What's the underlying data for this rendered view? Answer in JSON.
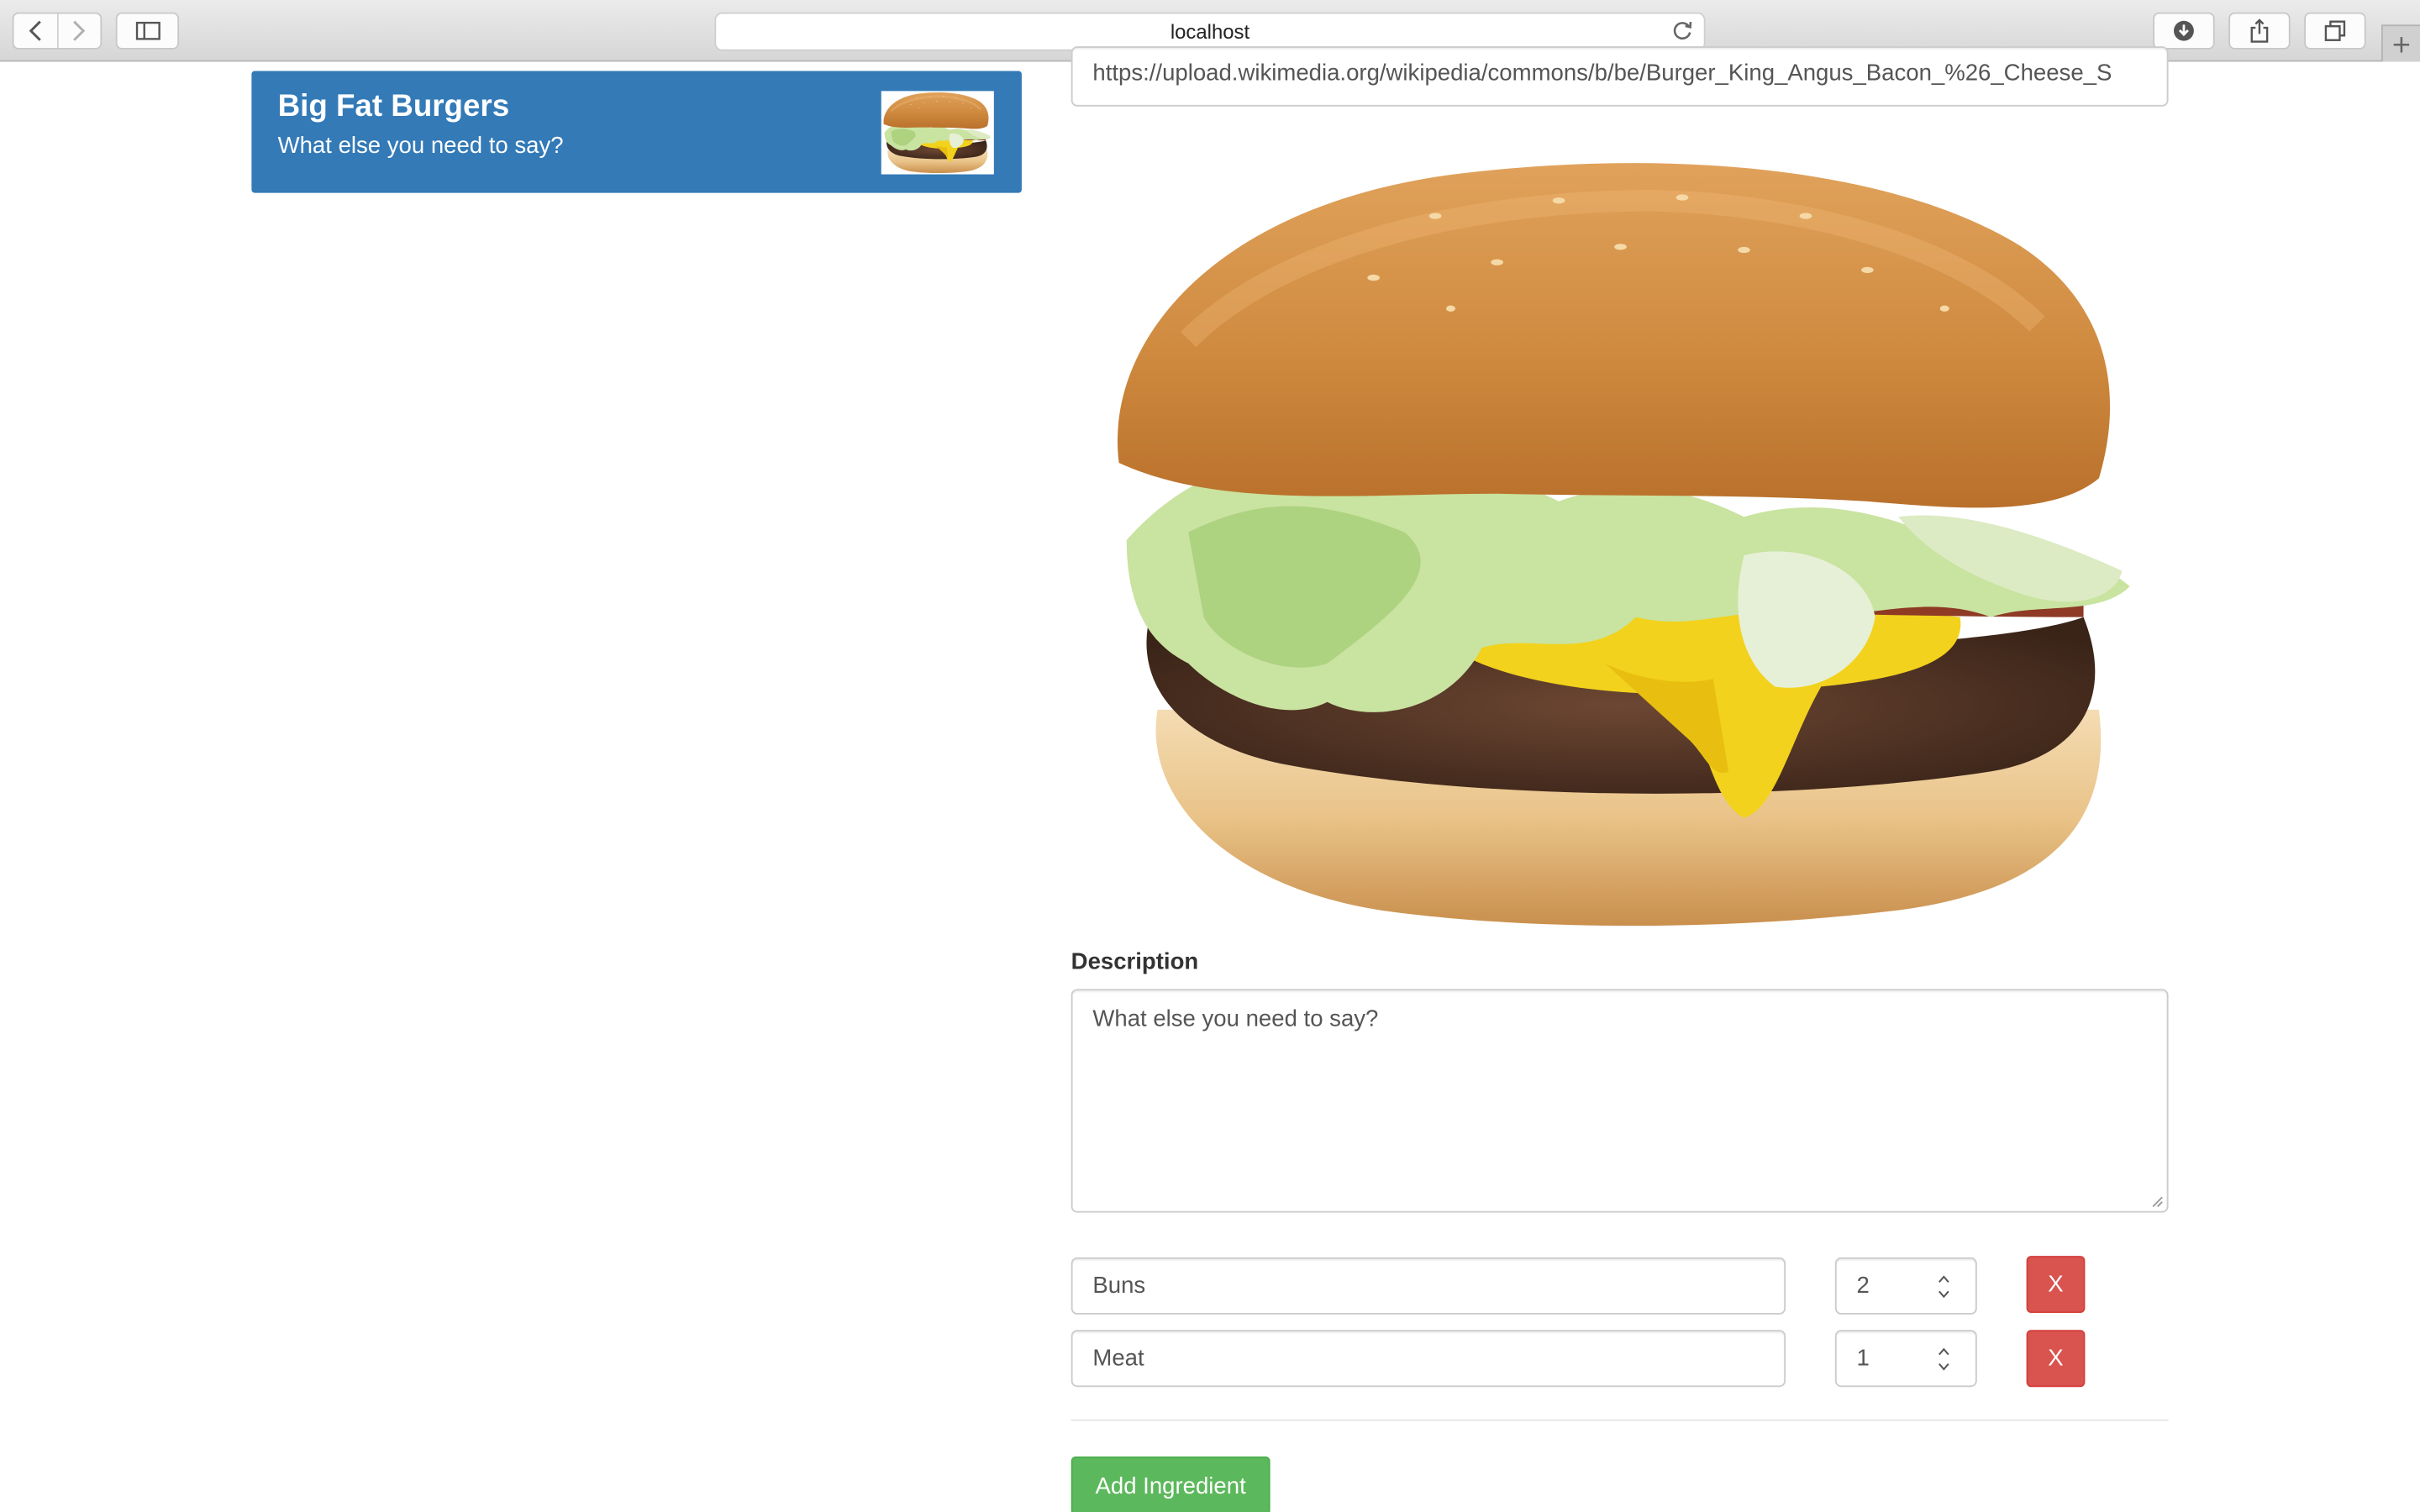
{
  "browser": {
    "url": "localhost",
    "toolbar_icons": [
      "back-arrow-icon",
      "forward-arrow-icon",
      "sidebar-icon",
      "reload-icon",
      "download-icon",
      "share-icon",
      "tabs-icon",
      "plus-icon"
    ]
  },
  "recipe_list": {
    "items": [
      {
        "title": "Big Fat Burgers",
        "description": "What else you need to say?",
        "selected": true,
        "thumbnail": "burger-photo"
      }
    ]
  },
  "editor": {
    "image_url": "https://upload.wikimedia.org/wikipedia/commons/b/be/Burger_King_Angus_Bacon_%26_Cheese_S",
    "image": "burger-photo",
    "description_label": "Description",
    "description_value": "What else you need to say?",
    "ingredients": [
      {
        "name": "Buns",
        "amount": "2",
        "remove_label": "X"
      },
      {
        "name": "Meat",
        "amount": "1",
        "remove_label": "X"
      }
    ],
    "add_ingredient_label": "Add Ingredient"
  },
  "colors": {
    "selected_item_bg": "#337ab7",
    "danger": "#d9534f",
    "success": "#5cb85c"
  }
}
